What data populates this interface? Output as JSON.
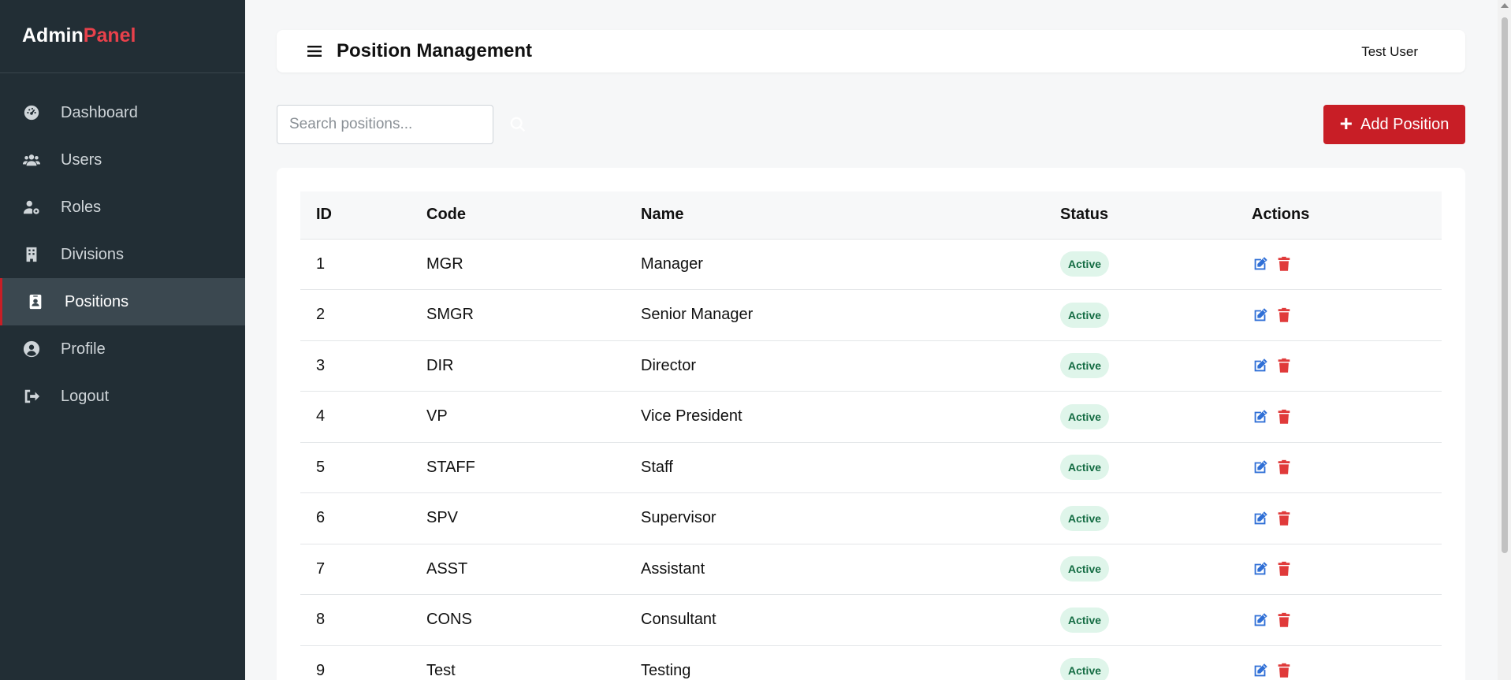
{
  "brand": {
    "part1": "Admin",
    "part2": "Panel"
  },
  "sidebar": {
    "items": [
      {
        "label": "Dashboard",
        "icon": "dashboard-gauge-icon",
        "active": false
      },
      {
        "label": "Users",
        "icon": "users-icon",
        "active": false
      },
      {
        "label": "Roles",
        "icon": "user-cog-icon",
        "active": false
      },
      {
        "label": "Divisions",
        "icon": "building-icon",
        "active": false
      },
      {
        "label": "Positions",
        "icon": "id-badge-icon",
        "active": true
      },
      {
        "label": "Profile",
        "icon": "user-circle-icon",
        "active": false
      },
      {
        "label": "Logout",
        "icon": "sign-out-icon",
        "active": false
      }
    ]
  },
  "header": {
    "title": "Position Management",
    "user": "Test User"
  },
  "search": {
    "placeholder": "Search positions...",
    "value": ""
  },
  "add_button": {
    "label": "Add Position"
  },
  "table": {
    "columns": [
      "ID",
      "Code",
      "Name",
      "Status",
      "Actions"
    ],
    "rows": [
      {
        "id": "1",
        "code": "MGR",
        "name": "Manager",
        "status": "Active"
      },
      {
        "id": "2",
        "code": "SMGR",
        "name": "Senior Manager",
        "status": "Active"
      },
      {
        "id": "3",
        "code": "DIR",
        "name": "Director",
        "status": "Active"
      },
      {
        "id": "4",
        "code": "VP",
        "name": "Vice President",
        "status": "Active"
      },
      {
        "id": "5",
        "code": "STAFF",
        "name": "Staff",
        "status": "Active"
      },
      {
        "id": "6",
        "code": "SPV",
        "name": "Supervisor",
        "status": "Active"
      },
      {
        "id": "7",
        "code": "ASST",
        "name": "Assistant",
        "status": "Active"
      },
      {
        "id": "8",
        "code": "CONS",
        "name": "Consultant",
        "status": "Active"
      },
      {
        "id": "9",
        "code": "Test",
        "name": "Testing",
        "status": "Active"
      }
    ]
  },
  "colors": {
    "sidebar_bg": "#222e35",
    "accent": "#c81e26",
    "brand_accent": "#e8414b",
    "edit": "#2f6fd6",
    "delete": "#e03a3a",
    "badge_bg": "#dff5ea",
    "badge_text": "#146c43"
  }
}
